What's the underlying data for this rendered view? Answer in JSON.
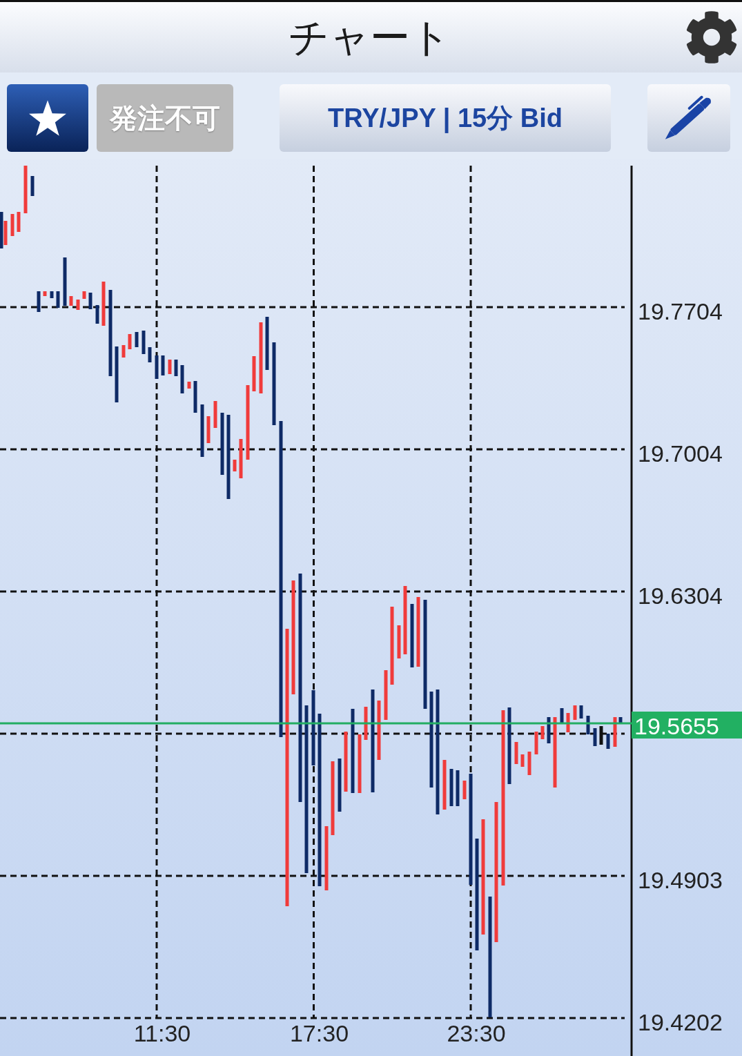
{
  "header": {
    "title": "チャート"
  },
  "toolbar": {
    "order_button": {
      "label": "発注不可",
      "disabled": true
    },
    "symbol_button": {
      "label": "TRY/JPY | 15分 Bid"
    }
  },
  "chart": {
    "y_axis_labels": [
      "19.7704",
      "19.7004",
      "19.6304",
      "19.4903",
      "19.4202"
    ],
    "x_axis_labels": [
      "11:30",
      "17:30",
      "23:30"
    ],
    "current_price": "19.5655"
  }
}
